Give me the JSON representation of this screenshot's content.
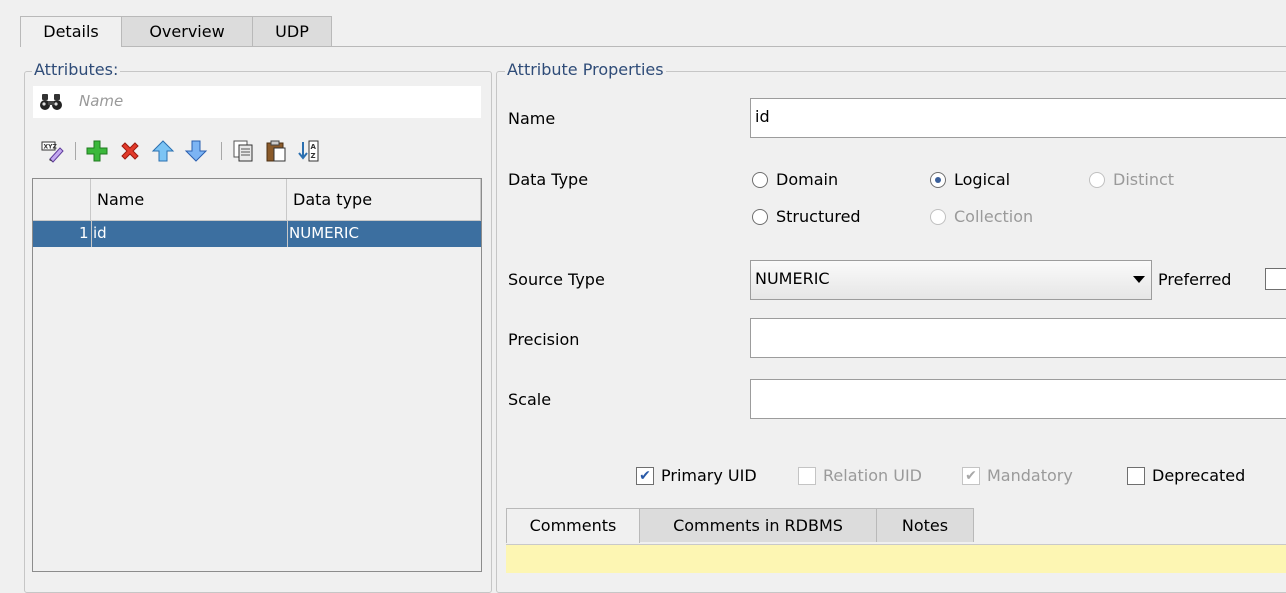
{
  "tabs": [
    "Details",
    "Overview",
    "UDP"
  ],
  "attributes": {
    "legend": "Attributes:",
    "search_placeholder": "Name",
    "toolbar": [
      "edit-icon",
      "add-icon",
      "delete-icon",
      "move-up-icon",
      "move-down-icon",
      "copy-icon",
      "paste-icon",
      "sort-icon"
    ],
    "columns": [
      "Name",
      "Data type"
    ],
    "rows": [
      {
        "num": "1",
        "name": "id",
        "type": "NUMERIC"
      }
    ]
  },
  "properties": {
    "legend": "Attribute Properties",
    "name_label": "Name",
    "name_value": "id",
    "data_type_label": "Data Type",
    "data_type_options": {
      "domain": "Domain",
      "logical": "Logical",
      "distinct": "Distinct",
      "structured": "Structured",
      "collection": "Collection"
    },
    "data_type_selected": "Logical",
    "source_type_label": "Source Type",
    "source_type_value": "NUMERIC",
    "preferred_label": "Preferred",
    "precision_label": "Precision",
    "precision_value": "",
    "scale_label": "Scale",
    "scale_value": "",
    "checks": {
      "primary_uid": "Primary UID",
      "relation_uid": "Relation UID",
      "mandatory": "Mandatory",
      "deprecated": "Deprecated"
    }
  },
  "bottom_tabs": [
    "Comments",
    "Comments in RDBMS",
    "Notes"
  ],
  "colors": {
    "selection": "#3c6fa0",
    "notes_bg": "#fdf6b3",
    "legend": "#2f4c78"
  }
}
